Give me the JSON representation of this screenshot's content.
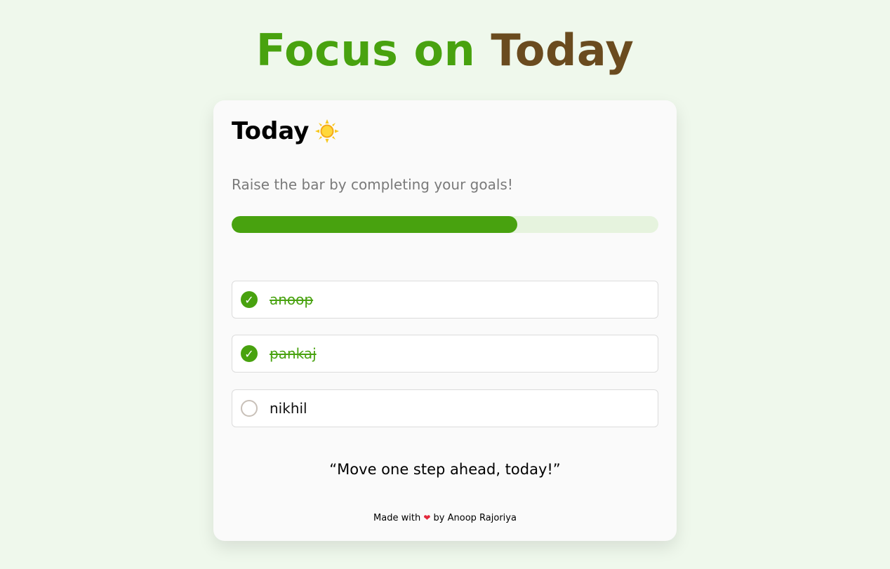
{
  "header": {
    "title_part1": "Focus on",
    "title_part2": "Today",
    "color_green": "#48a20f",
    "color_brown": "#6a4b1f"
  },
  "card": {
    "heading": "Today",
    "heading_icon": "sun-icon",
    "subtitle": "Raise the bar by completing your goals!",
    "progress": 0.67,
    "goals": [
      {
        "label": "anoop",
        "completed": true
      },
      {
        "label": "pankaj",
        "completed": true
      },
      {
        "label": "nikhil",
        "completed": false
      }
    ],
    "check_glyph": "✓",
    "quote": "“Move one step ahead, today!”",
    "footer": {
      "made_with": "Made with",
      "heart_icon": "heart-icon",
      "by_text": "by Anoop Rajoriya"
    }
  }
}
